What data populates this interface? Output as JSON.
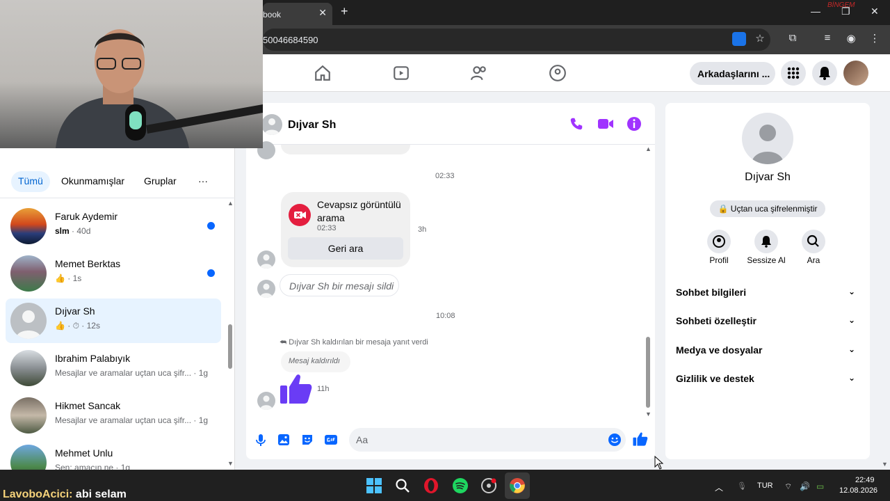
{
  "browser": {
    "tab_title": "book",
    "tab_close": "✕",
    "new_tab": "+",
    "url": "50046684590",
    "corner_tag": "BİNGEM"
  },
  "fb_nav": {
    "friends_button": "Arkadaşlarını ...",
    "icons": [
      "home-icon",
      "video-icon",
      "friends-icon",
      "groups-icon"
    ]
  },
  "chat_list": {
    "filters": [
      "Tümü",
      "Okunmamışlar",
      "Gruplar",
      "···"
    ],
    "items": [
      {
        "name": "Faruk Aydemir",
        "sub_bold": "slm",
        "sub_rest": " · 40d",
        "unread": true
      },
      {
        "name": "Memet Berktas",
        "sub_bold": "",
        "sub_rest": "👍 · 1s",
        "unread": true
      },
      {
        "name": "Dıjvar Sh",
        "sub_bold": "",
        "sub_rest": "👍 · ⏱ · 12s",
        "unread": false
      },
      {
        "name": "Ibrahim Palabıyık",
        "sub_bold": "",
        "sub_rest": "Mesajlar ve aramalar uçtan uca şifr... · 1g",
        "unread": false
      },
      {
        "name": "Hikmet Sancak",
        "sub_bold": "",
        "sub_rest": "Mesajlar ve aramalar uçtan uca şifr... · 1g",
        "unread": false
      },
      {
        "name": "Mehmet Unlu",
        "sub_bold": "",
        "sub_rest": "Sen: amacın ne · 1g",
        "unread": false
      }
    ]
  },
  "conversation": {
    "contact_name": "Dıjvar Sh",
    "time_1": "02:33",
    "call_title": "Cevapsız görüntülü arama",
    "call_time": "02:33",
    "call_age": "3h",
    "callback_label": "Geri ara",
    "deleted_message": "Dıjvar Sh bir mesajı sildi",
    "time_2": "10:08",
    "reply_note": "Dıjvar Sh kaldırılan bir mesaja yanıt verdi",
    "removed_message": "Mesaj kaldırıldı",
    "like_age": "11h",
    "composer_placeholder": "Aa"
  },
  "info_panel": {
    "name": "Dıjvar Sh",
    "encryption": "🔒 Uçtan uca şifrelenmiştir",
    "actions": [
      "Profil",
      "Sessize Al",
      "Ara"
    ],
    "sections": [
      "Sohbet bilgileri",
      "Sohbeti özelleştir",
      "Medya ve dosyalar",
      "Gizlilik ve destek"
    ]
  },
  "taskbar": {
    "language": "TUR",
    "time": "22:49",
    "date": "12.08.2026",
    "stream_user": "LavoboAcici:",
    "stream_message": "abi selam"
  },
  "colors": {
    "accent": "#0866ff",
    "messenger_purple": "#a033ff",
    "missed_call_red": "#e41e3f"
  }
}
